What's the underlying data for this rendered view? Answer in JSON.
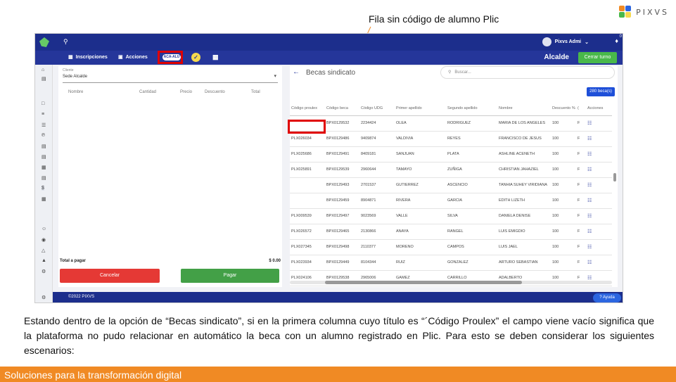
{
  "callout": "Fila sin código de alumno Plic",
  "logo_text": "PIXVS",
  "topbar": {
    "user_name": "Pixvs Admi",
    "bell_count": "0"
  },
  "navbar": {
    "inscripciones": "Inscripciones",
    "acciones": "Acciones",
    "pill": "ACA-ALU",
    "sede": "Alcalde",
    "cerrar_turno": "Cerrar turno"
  },
  "left_panel": {
    "client_label": "Cliente",
    "client_value": "Sede Alcalde",
    "columns": [
      "Nombre",
      "Cantidad",
      "Precio",
      "Descuento",
      "Total"
    ],
    "total_label": "Total a pagar",
    "total_value": "$ 0.00",
    "cancel": "Cancelar",
    "pay": "Pagar"
  },
  "right_panel": {
    "title": "Becas sindicato",
    "search_placeholder": "Buscar...",
    "badge": "280 beca(s)",
    "columns": [
      "Código proulex",
      "Código beca",
      "Código UDG",
      "Primer apellido",
      "Segundo apellido",
      "Nombre",
      "Descuento %",
      "(",
      "Acciones"
    ],
    "rows": [
      [
        "",
        "BPX0129532",
        "2234424",
        "OLEA",
        "RODRIGUEZ",
        "MARIA DE LOS ANGELES",
        "100",
        "F"
      ],
      [
        "PLX026034",
        "BPX0129486",
        "9409874",
        "VALDIVIA",
        "REYES",
        "FRANCISCO DE JESUS",
        "100",
        "F"
      ],
      [
        "PLX025686",
        "BPX0129491",
        "8409181",
        "SANJUAN",
        "PLATA",
        "ASHLINE ACENETH",
        "100",
        "F"
      ],
      [
        "PLX025891",
        "BPX0129539",
        "2960644",
        "TAMAYO",
        "ZUÑIGA",
        "CHRISTIAN JAHAZIEL",
        "100",
        "F"
      ],
      [
        "",
        "BPX0129493",
        "2701537",
        "GUTIERREZ",
        "ASCENCIO",
        "TANHIA SUHEY VIRIDIANA",
        "100",
        "F"
      ],
      [
        "",
        "BPX0129459",
        "8904871",
        "RIVERA",
        "GARCIA",
        "EDITH LIZETH",
        "100",
        "F"
      ],
      [
        "PLX009539",
        "BPX0129497",
        "9023569",
        "VALLE",
        "SILVA",
        "DANIELA DENISE",
        "100",
        "F"
      ],
      [
        "PLX026572",
        "BPX0129465",
        "2130866",
        "ANAYA",
        "RANGEL",
        "LUIS EMIGDIO",
        "100",
        "F"
      ],
      [
        "PLX027345",
        "BPX0129498",
        "2110377",
        "MORENO",
        "CAMPOS",
        "LUIS JAEL",
        "100",
        "F"
      ],
      [
        "PLX023934",
        "BPX0129449",
        "8104344",
        "RUIZ",
        "GONZALEZ",
        "ARTURO SEBASTIAN",
        "100",
        "F"
      ],
      [
        "PLX024106",
        "BPX0129538",
        "2965006",
        "GAMEZ",
        "CARRILLO",
        "ADALBERTO",
        "100",
        "F"
      ]
    ]
  },
  "footer": {
    "copyright": "©2022 PIXVS",
    "help": "Ayuda"
  },
  "paragraph": "Estando dentro de la opción de “Becas sindicato”, si en la primera columna cuyo título es “´Código Proulex” el campo viene vacío significa que la plataforma no pudo relacionar en automático la beca con un alumno registrado en Plic. Para esto se deben considerar los siguientes escenarios:",
  "bottom_bar": "Soluciones para la transformación digital",
  "colors": {
    "brand_blue": "#1c2e8c",
    "accent_orange": "#f08a24",
    "highlight_red": "#e00000",
    "cancel_red": "#e53935",
    "pay_green": "#43a047"
  }
}
